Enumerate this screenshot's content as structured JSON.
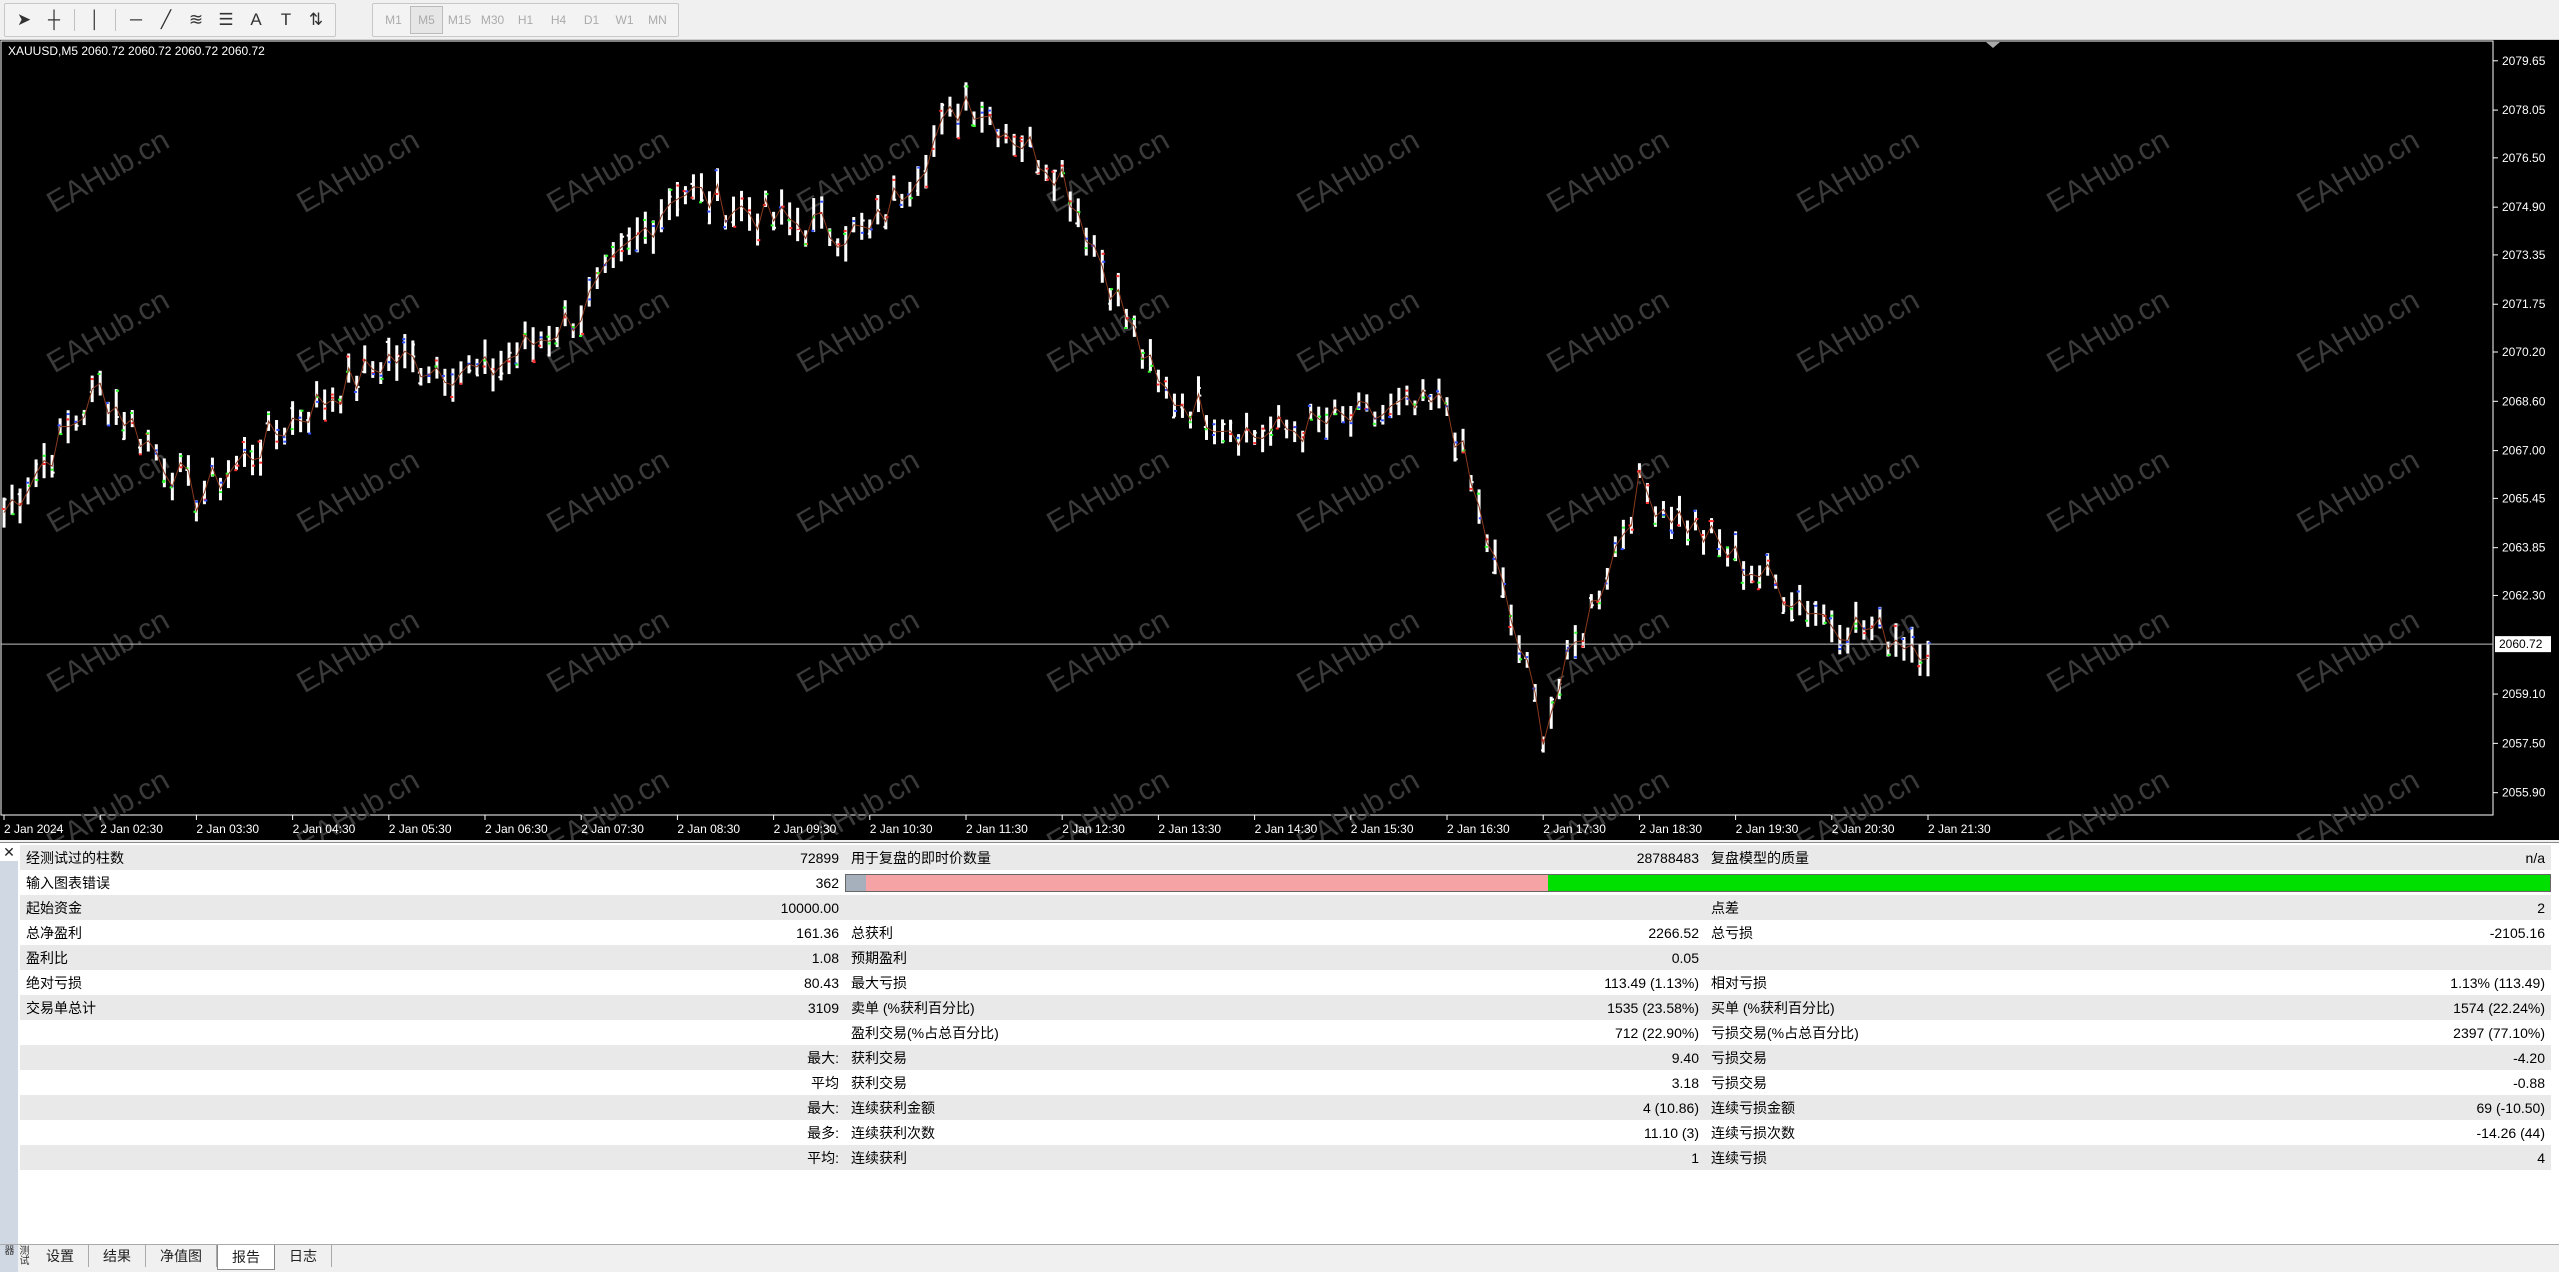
{
  "toolbar": {
    "tools": [
      {
        "name": "cursor-icon",
        "glyph": "➤"
      },
      {
        "name": "crosshair-icon",
        "glyph": "┼"
      },
      {
        "name": "vertical-line-icon",
        "glyph": "│"
      },
      {
        "name": "horizontal-line-icon",
        "glyph": "─"
      },
      {
        "name": "trendline-icon",
        "glyph": "╱"
      },
      {
        "name": "channel-icon",
        "glyph": "≋"
      },
      {
        "name": "fibonacci-icon",
        "glyph": "☰"
      },
      {
        "name": "text-icon",
        "glyph": "A"
      },
      {
        "name": "text-label-icon",
        "glyph": "T"
      },
      {
        "name": "arrows-icon",
        "glyph": "⇅"
      }
    ],
    "timeframes": [
      "M1",
      "M5",
      "M15",
      "M30",
      "H1",
      "H4",
      "D1",
      "W1",
      "MN"
    ],
    "active_timeframe": "M5"
  },
  "chart": {
    "symbol_line": "XAUUSD,M5  2060.72 2060.72 2060.72 2060.72",
    "current_price": "2060.72",
    "price_ticks": [
      "2079.65",
      "2078.05",
      "2076.50",
      "2074.90",
      "2073.35",
      "2071.75",
      "2070.20",
      "2068.60",
      "2067.00",
      "2065.45",
      "2063.85",
      "2062.30",
      "2059.10",
      "2057.50",
      "2055.90"
    ],
    "time_ticks": [
      "2 Jan 2024",
      "2 Jan 02:30",
      "2 Jan 03:30",
      "2 Jan 04:30",
      "2 Jan 05:30",
      "2 Jan 06:30",
      "2 Jan 07:30",
      "2 Jan 08:30",
      "2 Jan 09:30",
      "2 Jan 10:30",
      "2 Jan 11:30",
      "2 Jan 12:30",
      "2 Jan 13:30",
      "2 Jan 14:30",
      "2 Jan 15:30",
      "2 Jan 16:30",
      "2 Jan 17:30",
      "2 Jan 18:30",
      "2 Jan 19:30",
      "2 Jan 20:30",
      "2 Jan 21:30"
    ],
    "watermark": "EAHub.cn",
    "colors": {
      "background": "#000000",
      "axis": "#ffffff",
      "price_line": "#c0c0c0",
      "candle": "#ffffff"
    }
  },
  "chart_data": {
    "type": "line",
    "title": "XAUUSD,M5",
    "x": [
      "2 Jan 2024",
      "2 Jan 02:30",
      "2 Jan 03:30",
      "2 Jan 04:30",
      "2 Jan 05:30",
      "2 Jan 06:30",
      "2 Jan 07:30",
      "2 Jan 08:30",
      "2 Jan 09:30",
      "2 Jan 10:30",
      "2 Jan 11:30",
      "2 Jan 12:30",
      "2 Jan 13:30",
      "2 Jan 14:30",
      "2 Jan 15:30",
      "2 Jan 16:30",
      "2 Jan 17:30",
      "2 Jan 18:30",
      "2 Jan 19:30",
      "2 Jan 20:30",
      "2 Jan 21:30"
    ],
    "series": [
      {
        "values": [
          2065.0,
          2069.0,
          2065.5,
          2068.0,
          2070.0,
          2069.5,
          2071.5,
          2075.5,
          2074.5,
          2074.0,
          2078.5,
          2076.0,
          2069.0,
          2067.5,
          2068.0,
          2068.5,
          2058.0,
          2065.8,
          2063.5,
          2061.5,
          2060.7
        ]
      }
    ],
    "ylim": [
      2055.5,
      2080.0
    ],
    "last_price": 2060.72
  },
  "report": {
    "rows": [
      [
        "经测试过的柱数",
        "72899",
        "用于复盘的即时价数量",
        "28788483",
        "复盘模型的质量",
        "n/a"
      ],
      [
        "输入图表错误",
        "362",
        "__bar__",
        "",
        "",
        ""
      ],
      [
        "起始资金",
        "10000.00",
        "",
        "",
        "点差",
        "2"
      ],
      [
        "总净盈利",
        "161.36",
        "总获利",
        "2266.52",
        "总亏损",
        "-2105.16"
      ],
      [
        "盈利比",
        "1.08",
        "预期盈利",
        "0.05",
        "",
        ""
      ],
      [
        "绝对亏损",
        "80.43",
        "最大亏损",
        "113.49 (1.13%)",
        "相对亏损",
        "1.13% (113.49)"
      ],
      [
        "交易单总计",
        "3109",
        "卖单 (%获利百分比)",
        "1535 (23.58%)",
        "买单 (%获利百分比)",
        "1574 (22.24%)"
      ],
      [
        "",
        "",
        "盈利交易(%占总百分比)",
        "712 (22.90%)",
        "亏损交易(%占总百分比)",
        "2397 (77.10%)"
      ],
      [
        "",
        "最大:",
        "获利交易",
        "9.40",
        "亏损交易",
        "-4.20"
      ],
      [
        "",
        "平均",
        "获利交易",
        "3.18",
        "亏损交易",
        "-0.88"
      ],
      [
        "",
        "最大:",
        "连续获利金额",
        "4 (10.86)",
        "连续亏损金额",
        "69 (-10.50)"
      ],
      [
        "",
        "最多:",
        "连续获利次数",
        "11.10 (3)",
        "连续亏损次数",
        "-14.26 (44)"
      ],
      [
        "",
        "平均:",
        "连续获利",
        "1",
        "连续亏损",
        "4"
      ]
    ],
    "quality_bar": {
      "grey": 0.012,
      "red": 0.4,
      "green": 0.588
    }
  },
  "tabs": {
    "side_label": "测试器",
    "items": [
      "设置",
      "结果",
      "净值图",
      "报告",
      "日志"
    ],
    "active": "报告"
  }
}
